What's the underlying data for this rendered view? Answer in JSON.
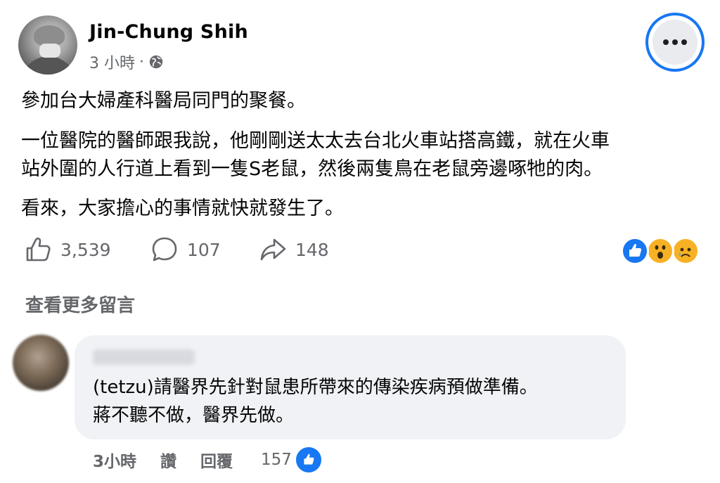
{
  "post": {
    "author": "Jin-Chung Shih",
    "time": "3 小時",
    "separator": "·",
    "paragraphs": [
      "參加台大婦產科醫局同門的聚餐。",
      "一位醫院的醫師跟我說，他剛剛送太太去台北火車站搭高鐵，就在火車",
      "站外圍的人行道上看到一隻S老鼠，然後兩隻鳥在老鼠旁邊啄牠的肉。",
      "看來，大家擔心的事情就快就發生了。"
    ],
    "likes": "3,539",
    "comments": "107",
    "shares": "148"
  },
  "see_more_comments": "查看更多留言",
  "comment": {
    "text_line1": "(tetzu)請醫界先針對鼠患所帶來的傳染疾病預做準備。",
    "text_line2": "蔣不聽不做，醫界先做。",
    "time": "3小時",
    "like_label": "讚",
    "reply_label": "回覆",
    "reaction_count": "157"
  },
  "colors": {
    "accent": "#1877f2",
    "secondary_text": "#65676b",
    "bubble": "#f0f2f5"
  },
  "icons": [
    "globe-icon",
    "more-icon",
    "like-icon",
    "comment-icon",
    "share-icon",
    "like-reaction-icon",
    "wow-reaction-icon",
    "sad-reaction-icon"
  ]
}
